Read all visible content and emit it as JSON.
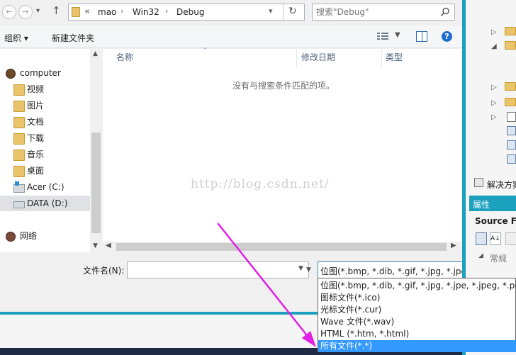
{
  "nav": {
    "back": "←",
    "forward": "→",
    "recent": "▾",
    "up": "↑"
  },
  "address": {
    "overflow": "«",
    "segments": [
      "mao",
      "Win32",
      "Debug"
    ]
  },
  "search": {
    "placeholder": "搜索\"Debug\""
  },
  "toolbar": {
    "organize": "组织 ▾",
    "new_folder": "新建文件夹"
  },
  "tree": {
    "items": [
      {
        "label": "computer",
        "icon": "computer-icon"
      },
      {
        "label": "视频",
        "icon": "videos-folder-icon"
      },
      {
        "label": "图片",
        "icon": "pictures-folder-icon"
      },
      {
        "label": "文档",
        "icon": "documents-folder-icon"
      },
      {
        "label": "下载",
        "icon": "downloads-folder-icon"
      },
      {
        "label": "音乐",
        "icon": "music-folder-icon"
      },
      {
        "label": "桌面",
        "icon": "desktop-folder-icon"
      },
      {
        "label": "Acer (C:)",
        "icon": "windows-drive-icon"
      },
      {
        "label": "DATA (D:)",
        "icon": "drive-icon"
      },
      {
        "label": "网络",
        "icon": "network-icon"
      }
    ]
  },
  "columns": [
    {
      "label": "名称"
    },
    {
      "label": "修改日期"
    },
    {
      "label": "类型"
    }
  ],
  "empty_message": "没有与搜索条件匹配的项。",
  "watermark": "http://blog.csdn.net/",
  "filename": {
    "label": "文件名(N):",
    "value": ""
  },
  "filetype": {
    "selected": "位图(*.bmp, *.dib, *.gif, *.jpg, *.jpe, *.jpeg, *.png)",
    "options": [
      "位图(*.bmp, *.dib, *.gif, *.jpg, *.jpe, *.jpeg, *.png)",
      "图标文件(*.ico)",
      "光标文件(*.cur)",
      "Wave 文件(*.wav)",
      "HTML (*.htm, *.html)",
      "所有文件(*.*)"
    ],
    "highlighted_index": 5
  },
  "right_panel": {
    "solution_label": "解决方案",
    "properties_label": "属性",
    "source_label": "Source File",
    "category_label": "常规"
  },
  "colors": {
    "accent": "#1ba1bd",
    "highlight": "#3399ff",
    "arrow": "#e020e8"
  }
}
